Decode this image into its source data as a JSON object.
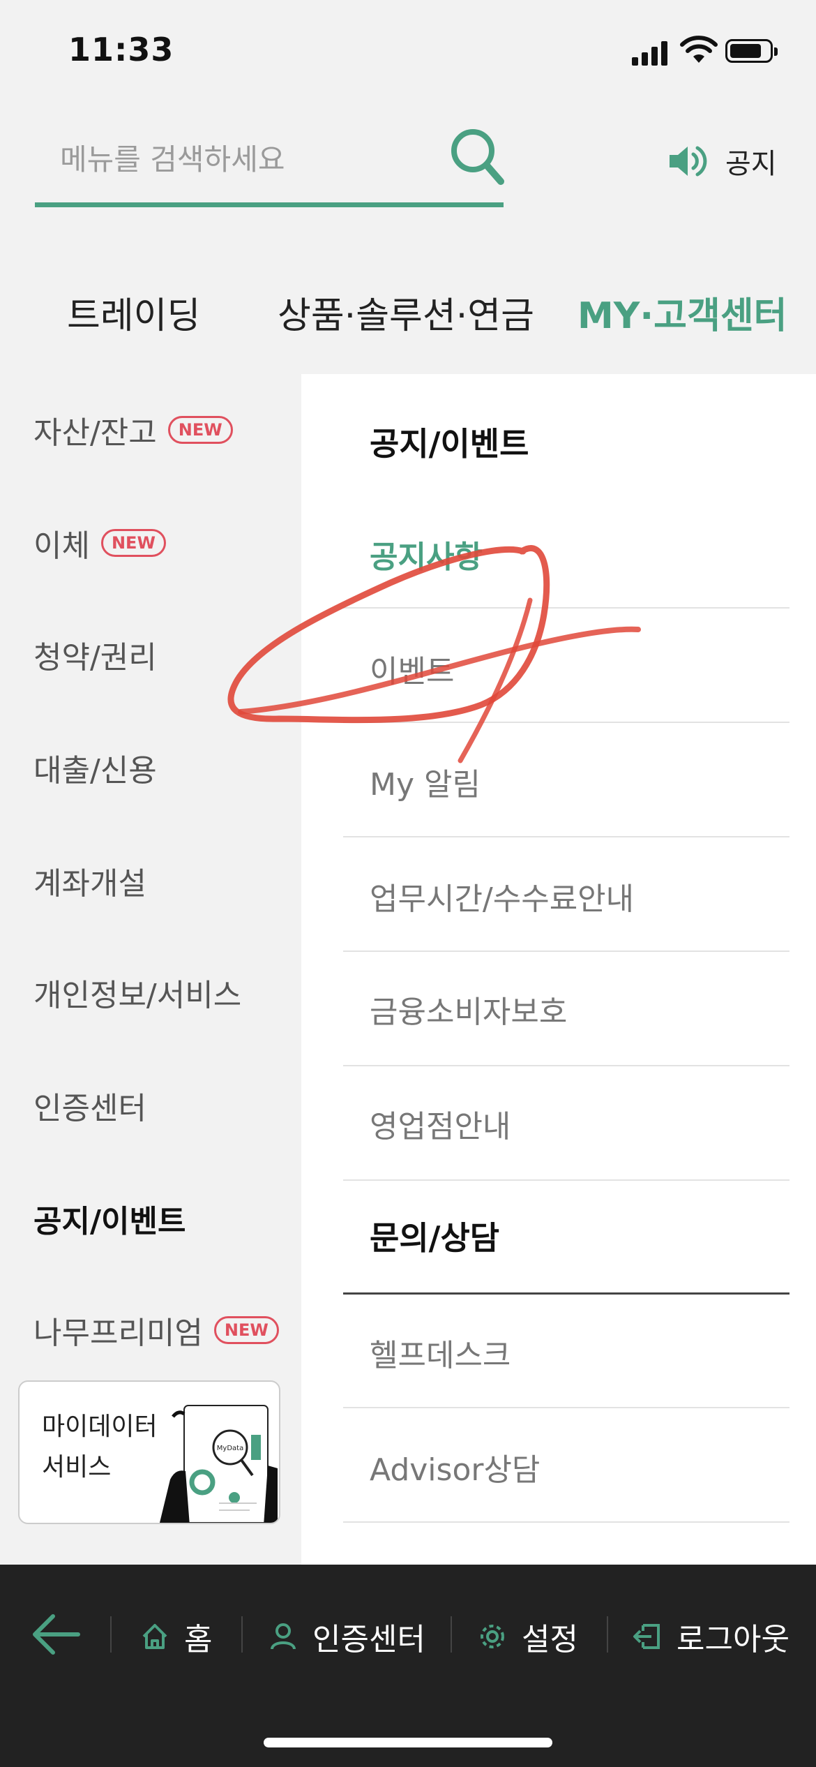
{
  "status_bar": {
    "time": "11:33"
  },
  "search": {
    "placeholder": "메뉴를 검색하세요",
    "icon": "search-icon"
  },
  "notice": {
    "label": "공지",
    "icon": "speaker-icon"
  },
  "tabs": [
    {
      "label": "트레이딩"
    },
    {
      "label": "상품·솔루션·연금"
    },
    {
      "label": "MY·고객센터",
      "active": true
    }
  ],
  "sidebar": {
    "items": [
      {
        "label": "자산/잔고",
        "badge": "NEW"
      },
      {
        "label": "이체",
        "badge": "NEW"
      },
      {
        "label": "청약/권리"
      },
      {
        "label": "대출/신용"
      },
      {
        "label": "계좌개설"
      },
      {
        "label": "개인정보/서비스"
      },
      {
        "label": "인증센터"
      },
      {
        "label": "공지/이벤트",
        "active": true
      },
      {
        "label": "나무프리미엄",
        "badge": "NEW"
      }
    ],
    "banner": {
      "line1": "마이데이터",
      "line2": "서비스",
      "image_text": "MyData"
    }
  },
  "panel": {
    "section1": {
      "title": "공지/이벤트",
      "items": [
        "공지사항",
        "이벤트",
        "My 알림",
        "업무시간/수수료안내",
        "금융소비자보호",
        "영업점안내"
      ]
    },
    "section2": {
      "title": "문의/상담",
      "items": [
        "헬프데스크",
        "Advisor상담"
      ]
    }
  },
  "bottom_nav": {
    "back_icon": "arrow-left-icon",
    "items": [
      {
        "label": "홈",
        "icon": "home-icon"
      },
      {
        "label": "인증센터",
        "icon": "person-icon"
      },
      {
        "label": "설정",
        "icon": "gear-icon"
      },
      {
        "label": "로그아웃",
        "icon": "logout-icon"
      }
    ]
  },
  "colors": {
    "accent": "#4aa082",
    "badge": "#e0505e",
    "scribble": "#e0483a",
    "bottom_bar": "#222222"
  }
}
